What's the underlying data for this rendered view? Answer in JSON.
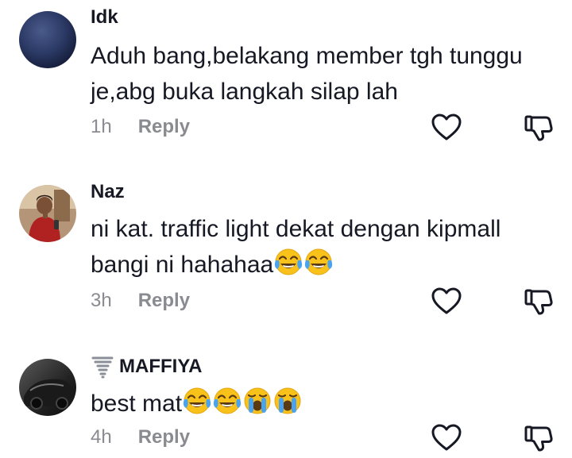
{
  "comments": [
    {
      "username": "Idk",
      "text": "Aduh bang,belakang member tgh tunggu je,abg buka langkah silap lah",
      "emojis": [],
      "time": "1h",
      "reply_label": "Reply",
      "avatar": "dark-blue-gradient-avatar"
    },
    {
      "username": "Naz",
      "text": "ni kat. traffic light dekat dengan kipmall bangi ni hahahaa",
      "emojis": [
        "tears-of-joy",
        "tears-of-joy"
      ],
      "time": "3h",
      "reply_label": "Reply",
      "avatar": "man-in-red-shirt-photo-avatar"
    },
    {
      "username": "MAFFIYA",
      "badge": "tornado-icon",
      "text": "best mat",
      "emojis": [
        "tears-of-joy",
        "tears-of-joy",
        "loudly-crying",
        "loudly-crying"
      ],
      "time": "4h",
      "reply_label": "Reply",
      "avatar": "dark-car-photo-avatar"
    }
  ],
  "icons": {
    "like": "heart-outline-icon",
    "dislike": "thumbs-down-outline-icon"
  },
  "colors": {
    "text": "#161823",
    "muted": "#8a8b91"
  }
}
